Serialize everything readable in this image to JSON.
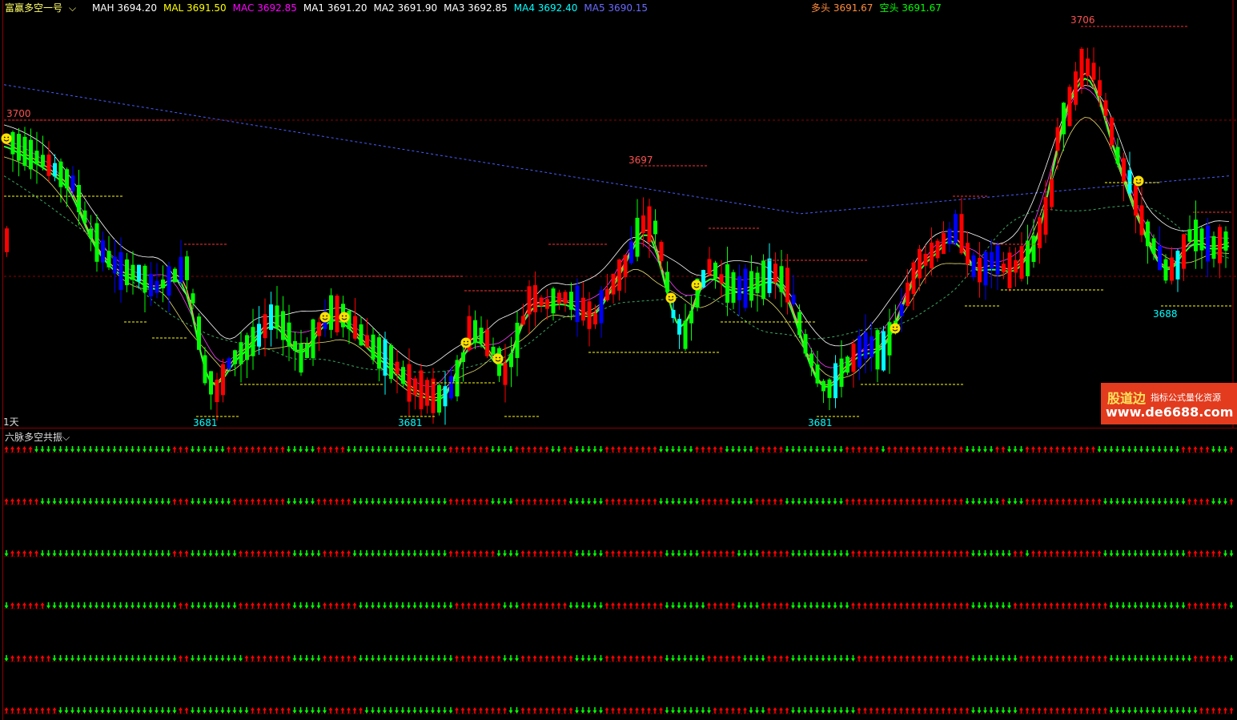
{
  "main_chart": {
    "indicator_name": "富赢多空一号",
    "legend": [
      {
        "label": "MAH",
        "value": "3694.20",
        "color": "#ffffff"
      },
      {
        "label": "MAL",
        "value": "3691.50",
        "color": "#ffff00"
      },
      {
        "label": "MAC",
        "value": "3692.85",
        "color": "#ff00ff"
      },
      {
        "label": "MA1",
        "value": "3691.20",
        "color": "#ffffff"
      },
      {
        "label": "MA2",
        "value": "3691.90",
        "color": "#ffffff"
      },
      {
        "label": "MA3",
        "value": "3692.85",
        "color": "#ffffff"
      },
      {
        "label": "MA4",
        "value": "3692.40",
        "color": "#00ffff"
      },
      {
        "label": "MA5",
        "value": "3690.15",
        "color": "#6a6aff"
      }
    ],
    "legend_right": [
      {
        "label": "多头",
        "value": "3691.67",
        "color": "#ff8c3a"
      },
      {
        "label": "空头",
        "value": "3691.67",
        "color": "#00ff00"
      }
    ],
    "period": "1天",
    "price_labels": [
      {
        "text": "3706",
        "color": "#ff5050"
      },
      {
        "text": "3700",
        "color": "#ff5050"
      },
      {
        "text": "3697",
        "color": "#ff5050"
      },
      {
        "text": "3681",
        "color": "#00ffff"
      },
      {
        "text": "3681",
        "color": "#00ffff"
      },
      {
        "text": "3681",
        "color": "#00ffff"
      },
      {
        "text": "3688",
        "color": "#00ffff"
      }
    ],
    "colors": {
      "up": "#ff0000",
      "down": "#00ff00",
      "neutral": "#0000ff",
      "cyan": "#00ffff"
    }
  },
  "sub_chart": {
    "indicator_name": "六脉多空共振",
    "rows": 6,
    "colors": {
      "bull": "#ff0000",
      "bear": "#00ff00"
    }
  },
  "watermark": {
    "brand": "股道边",
    "slogan": "指标公式量化资源",
    "url": "www.de6688.com"
  }
}
